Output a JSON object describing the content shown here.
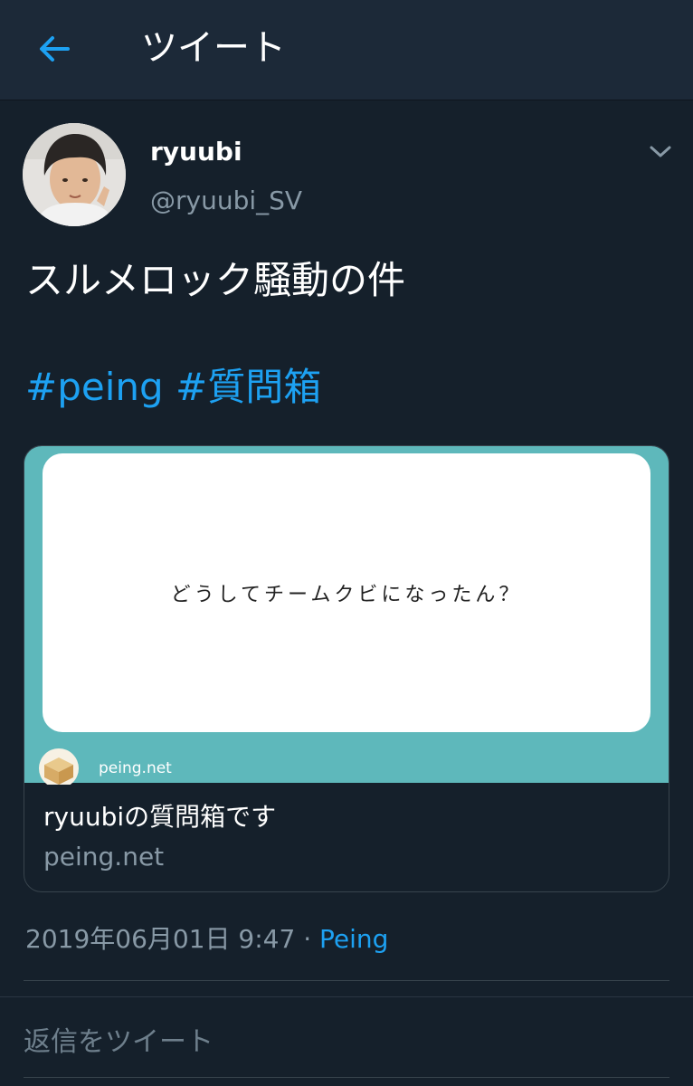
{
  "header": {
    "title": "ツイート",
    "back_icon": "arrow-left-icon",
    "accent": "#1da1f2"
  },
  "tweet": {
    "display_name": "ryuubi",
    "handle": "@ryuubi_SV",
    "menu_icon": "chevron-down-icon",
    "text": "スルメロック騒動の件",
    "hashtags": [
      "#peing",
      "#質問箱"
    ],
    "card": {
      "question": "どうしてチームクビになったん？",
      "media_site": "peing.net",
      "title": "ryuubiの質問箱です",
      "domain": "peing.net",
      "media_bg": "#5eb8bb"
    },
    "timestamp": "2019年06月01日 9:47",
    "separator": " · ",
    "source": "Peing"
  },
  "reply": {
    "placeholder": "返信をツイート"
  }
}
